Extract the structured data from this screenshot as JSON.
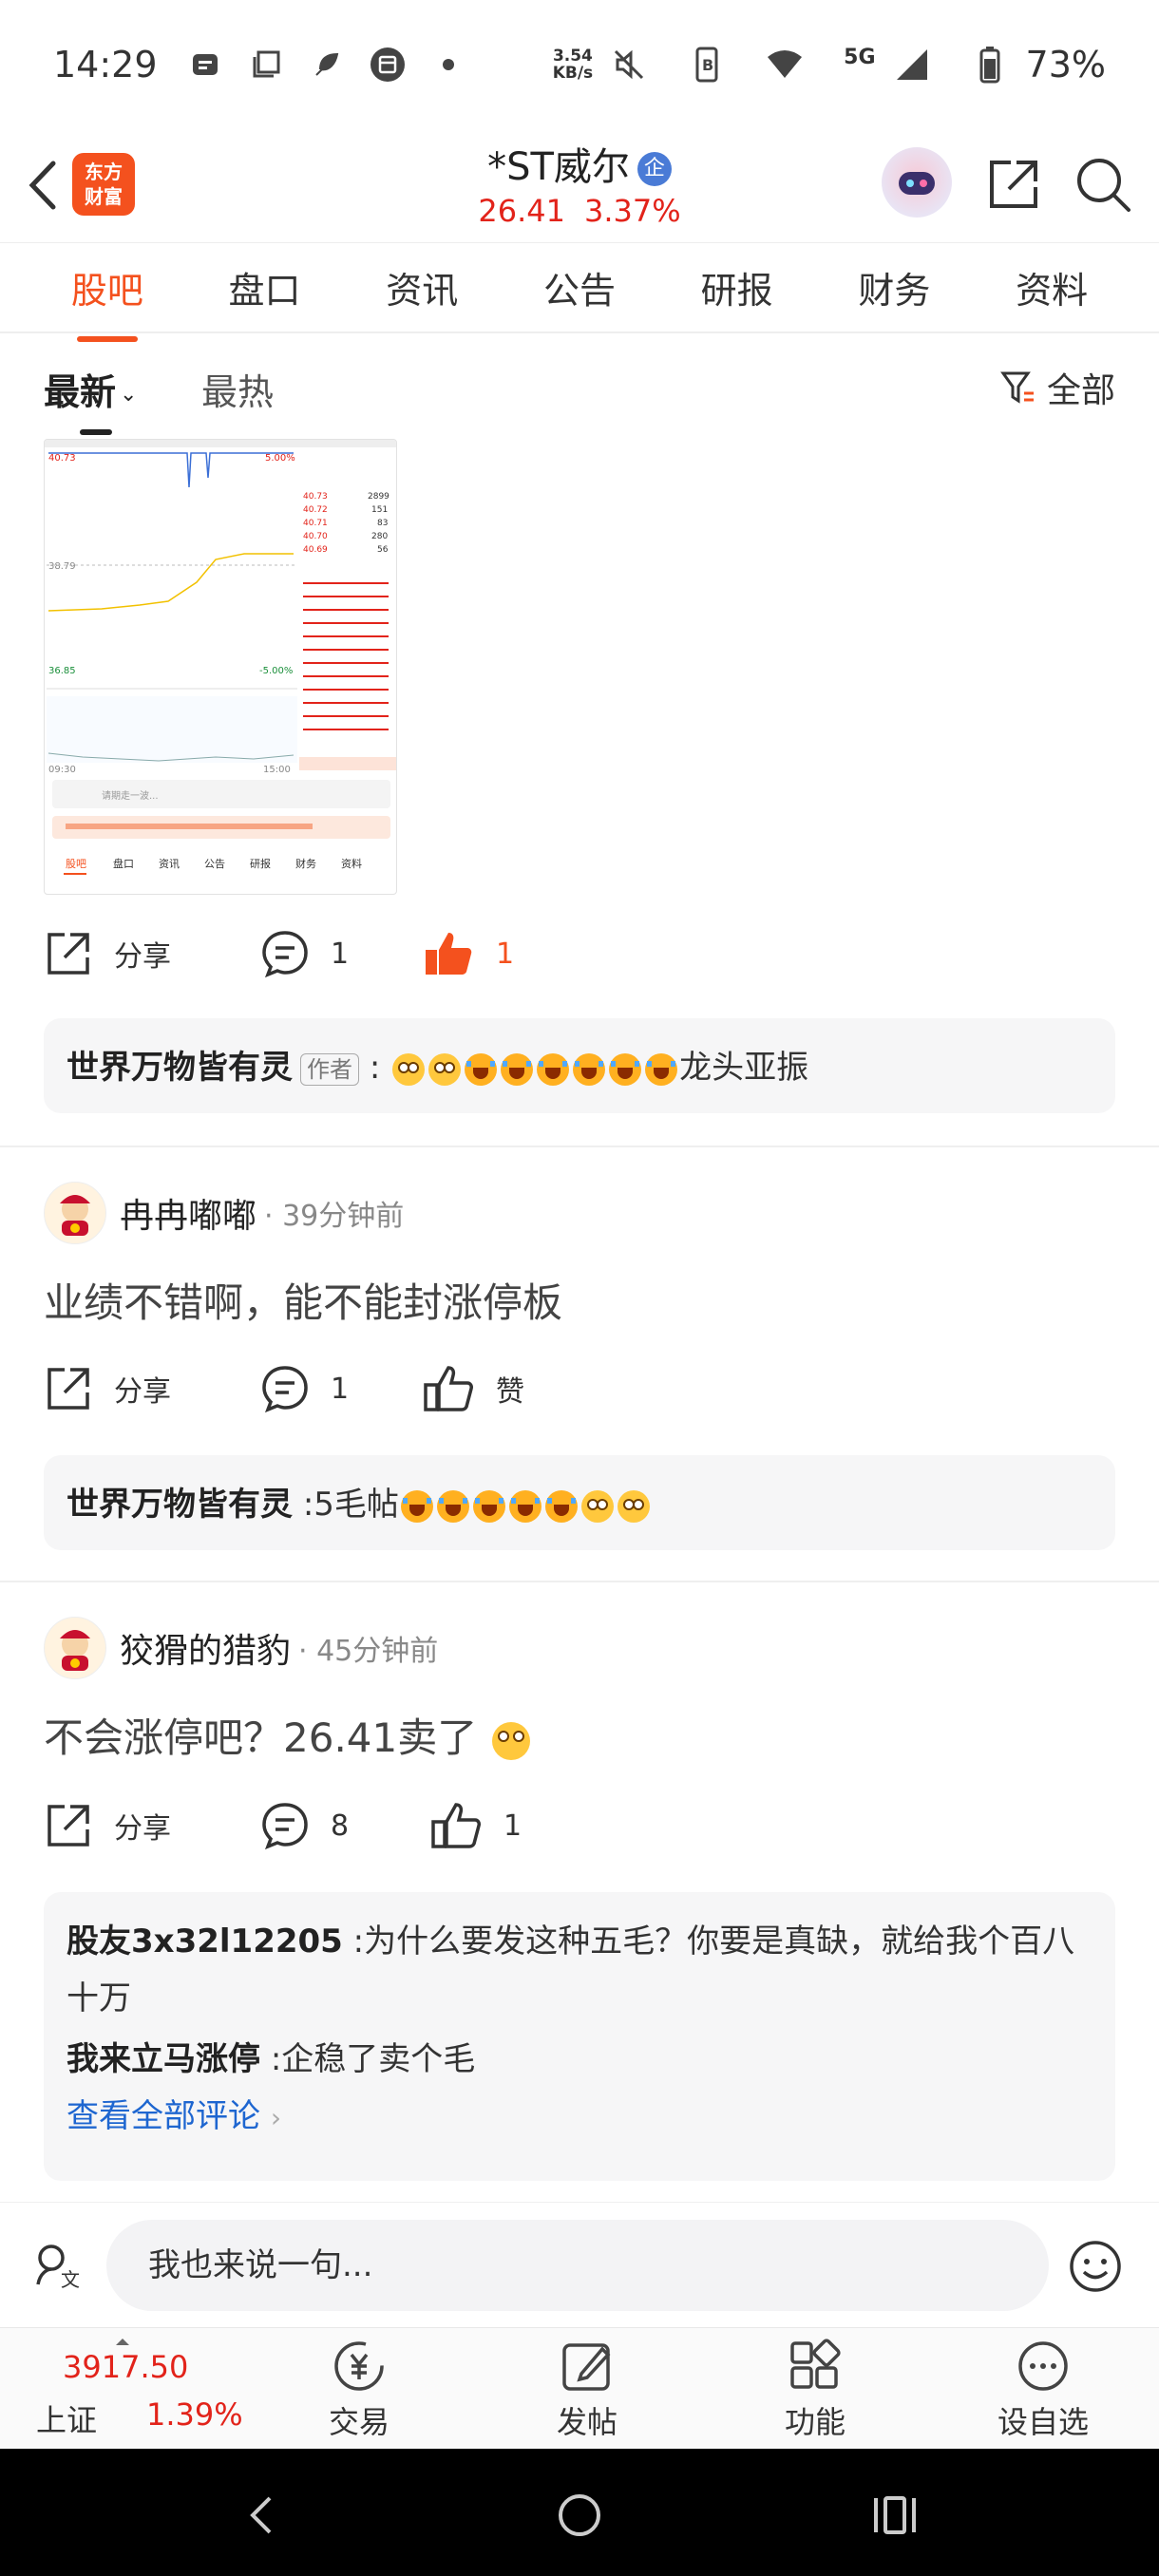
{
  "status_bar": {
    "time": "14:29",
    "net_speed_value": "3.54",
    "net_speed_unit": "KB/s",
    "network": "5G",
    "battery": "73%"
  },
  "header": {
    "logo_line1": "东方",
    "logo_line2": "财富",
    "stock_name": "*ST威尔",
    "badge": "企",
    "price": "26.41",
    "change_pct": "3.37%"
  },
  "tabs": [
    "股吧",
    "盘口",
    "资讯",
    "公告",
    "研报",
    "财务",
    "资料"
  ],
  "filter": {
    "newest": "最新",
    "hottest": "最热",
    "all": "全部"
  },
  "thumbnail": {
    "price_high": "40.73",
    "pct_high": "5.00%",
    "price_mid": "38.79",
    "price_low": "36.85",
    "pct_low": "-5.00%",
    "time_start": "09:30",
    "time_end": "15:00",
    "tabs": [
      "股吧",
      "盘口",
      "资讯",
      "公告",
      "研报",
      "财务",
      "资料"
    ],
    "input_placeholder": "请期走一波..."
  },
  "post1": {
    "share": "分享",
    "comments": "1",
    "likes": "1",
    "reply": {
      "author": "世界万物皆有灵",
      "tag": "作者",
      "sep": ":",
      "text": "龙头亚振"
    }
  },
  "post2": {
    "user": "冉冉嘟嘟",
    "time": "· 39分钟前",
    "text": "业绩不错啊，能不能封涨停板",
    "share": "分享",
    "comments": "1",
    "likes": "赞",
    "reply": {
      "author": "世界万物皆有灵",
      "sep": ":",
      "text": "5毛帖"
    }
  },
  "post3": {
    "user": "狡猾的猎豹",
    "time": "· 45分钟前",
    "text": "不会涨停吧？26.41卖了",
    "share": "分享",
    "comments": "8",
    "likes": "1",
    "replies": [
      {
        "author": "股友3x32l12205",
        "sep": ":",
        "text": "为什么要发这种五毛？你要是真缺，就给我个百八十万"
      },
      {
        "author": "我来立马涨停",
        "sep": ":",
        "text": "企稳了卖个毛"
      }
    ],
    "view_all": "查看全部评论"
  },
  "composer": {
    "placeholder": "我也来说一句..."
  },
  "toolbar": {
    "index_value": "3917.50",
    "index_name": "上证",
    "index_pct": "1.39%",
    "items": [
      "交易",
      "发帖",
      "功能",
      "设自选"
    ]
  },
  "colors": {
    "accent": "#f4511e",
    "up_red": "#e2231a",
    "link_blue": "#1e66d0"
  }
}
